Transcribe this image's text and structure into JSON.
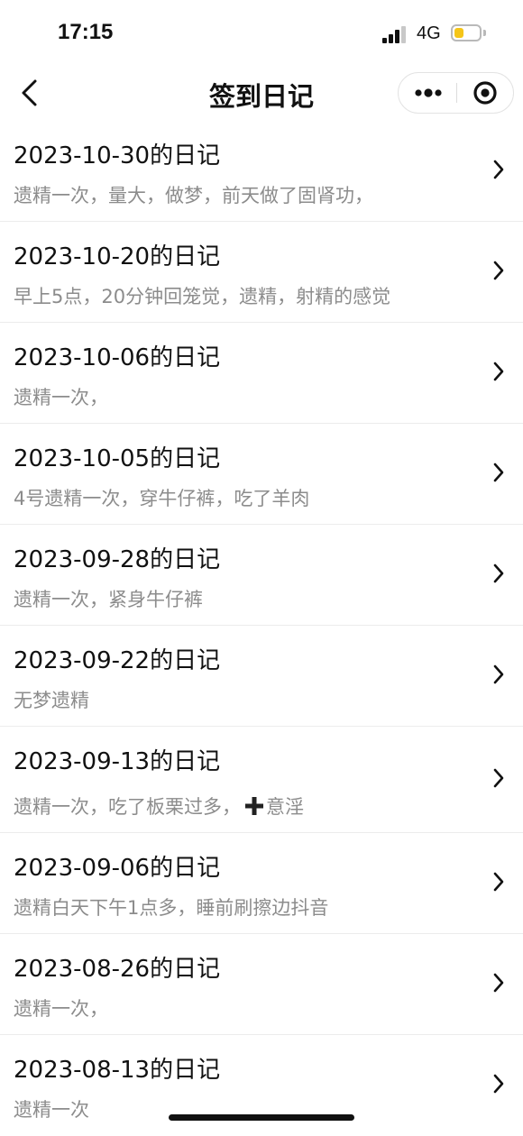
{
  "status_bar": {
    "time": "17:15",
    "network": "4G",
    "signal_bars_active": 3,
    "signal_bars_total": 4,
    "battery_level": 0.4,
    "battery_color": "#f5c518"
  },
  "nav": {
    "title": "签到日记"
  },
  "colors": {
    "title_text": "#111111",
    "summary_text": "#8c8c8c",
    "divider": "#ececec"
  },
  "diary": {
    "entries": [
      {
        "title": "2023-10-30的日记",
        "summary": "遗精一次，量大，做梦，前天做了固肾功，"
      },
      {
        "title": "2023-10-20的日记",
        "summary": "早上5点，20分钟回笼觉，遗精，射精的感觉"
      },
      {
        "title": "2023-10-06的日记",
        "summary": "遗精一次，"
      },
      {
        "title": "2023-10-05的日记",
        "summary": "4号遗精一次，穿牛仔裤，吃了羊肉"
      },
      {
        "title": "2023-09-28的日记",
        "summary": "遗精一次，紧身牛仔裤"
      },
      {
        "title": "2023-09-22的日记",
        "summary": "无梦遗精"
      },
      {
        "title": "2023-09-13的日记",
        "summary": "遗精一次，吃了板栗过多，",
        "summary_icon": "plus-icon",
        "summary_suffix": "意淫"
      },
      {
        "title": "2023-09-06的日记",
        "summary": "遗精白天下午1点多，睡前刷擦边抖音"
      },
      {
        "title": "2023-08-26的日记",
        "summary": "遗精一次，"
      },
      {
        "title": "2023-08-13的日记",
        "summary": "遗精一次"
      }
    ]
  }
}
